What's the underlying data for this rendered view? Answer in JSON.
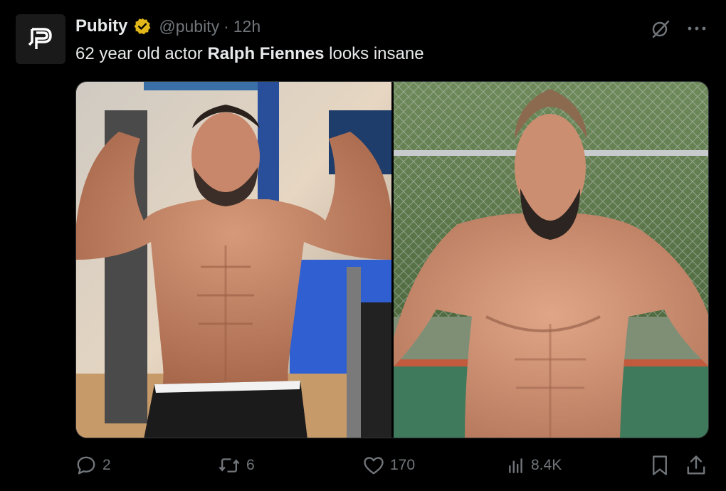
{
  "author": {
    "name": "Pubity",
    "handle": "@pubity",
    "separator": "·",
    "time": "12h",
    "avatar_icon": "pubity-logo-icon",
    "verified_icon": "verified-badge-icon",
    "verified_color": "#e2b719"
  },
  "tweet": {
    "text_before": "62 year old actor ",
    "text_bold": "Ralph Fiennes",
    "text_after": " looks insane"
  },
  "media": [
    {
      "description_icon": "photo-gym-flex"
    },
    {
      "description_icon": "photo-outdoor-court"
    }
  ],
  "top_actions": {
    "grok_icon": "grok-icon",
    "more_icon": "more-dots-icon"
  },
  "actions": {
    "reply_count": "2",
    "repost_count": "6",
    "like_count": "170",
    "views_count": "8.4K"
  },
  "colors": {
    "text": "#e7e9ea",
    "muted": "#71767b",
    "background": "#000000"
  }
}
